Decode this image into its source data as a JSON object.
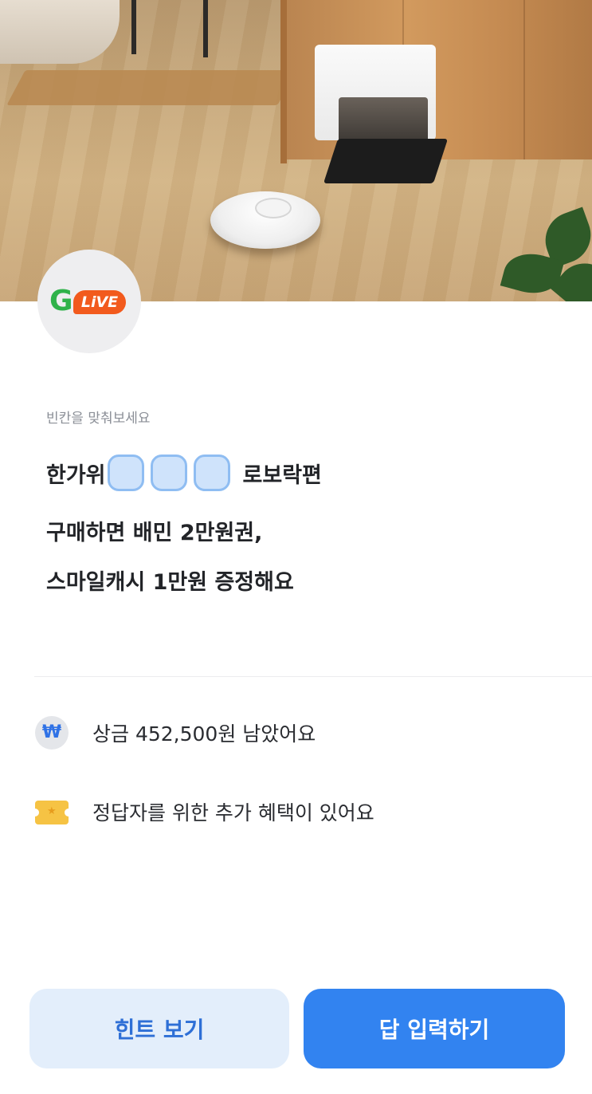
{
  "hero": {
    "image_alt": "robot vacuum with docking station on wooden floor"
  },
  "logo": {
    "letter": "G",
    "badge_text": "LiVE",
    "colors": {
      "g": "#2fb24a",
      "live_bg": "#f25a1d"
    }
  },
  "quiz": {
    "instruction": "빈칸을 맞춰보세요",
    "line1_prefix": "한가위",
    "blank_count": 3,
    "line1_suffix": "로보락편",
    "line2": "구매하면 배민 2만원권,",
    "line3": "스마일캐시 1만원 증정해요"
  },
  "info": {
    "prize_icon": "won-icon",
    "prize_text": "상금 452,500원 남았어요",
    "benefit_icon": "ticket-icon",
    "benefit_text": "정답자를 위한 추가 혜택이 있어요"
  },
  "buttons": {
    "hint_label": "힌트 보기",
    "answer_label": "답 입력하기"
  },
  "colors": {
    "accent": "#3283f0",
    "hint_bg": "#e3eefb",
    "blank_fill": "#cfe3fb",
    "blank_border": "#8fbdf2"
  }
}
